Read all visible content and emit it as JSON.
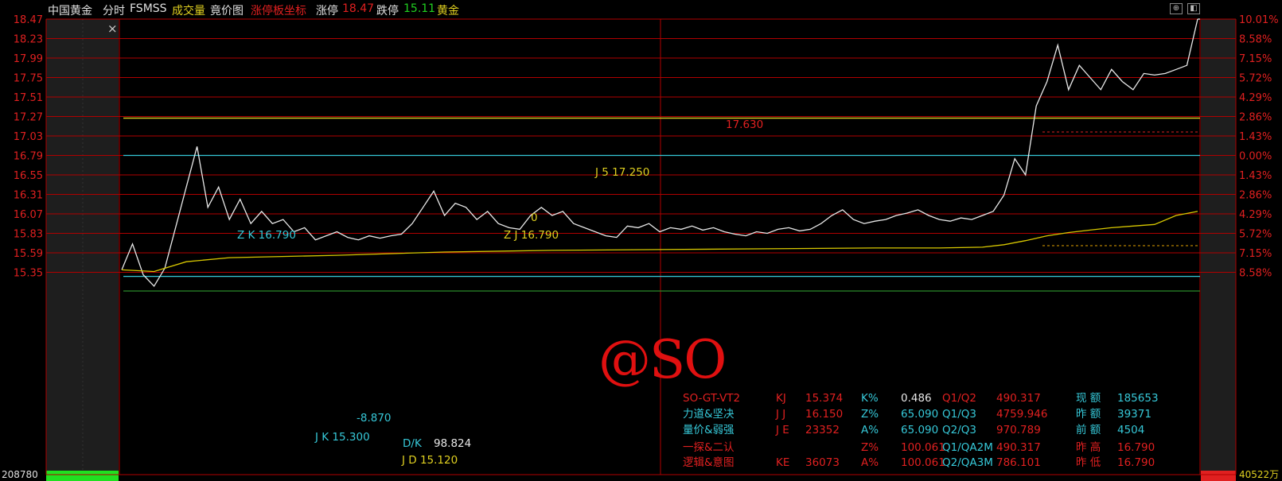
{
  "toolbar": {
    "stock_name": "中国黄金",
    "mode": "分时",
    "indicator": "FSMSS",
    "volume_label": "成交量",
    "auction_label": "竟价图",
    "limit_coord_label": "涨停板坐标",
    "limit_up_label": "涨停",
    "limit_up_value": "18.47",
    "limit_down_label": "跌停",
    "limit_down_value": "15.11",
    "sector": "黄金"
  },
  "colors": {
    "grid": "#b00000",
    "price_line": "#e8e8e8",
    "avg_line": "#d8c800",
    "cyan": "#36c8d8",
    "yellow": "#e0d020",
    "red": "#e02020",
    "white": "#e8e8e8"
  },
  "left_axis": [
    "18.47",
    "18.23",
    "17.99",
    "17.75",
    "17.51",
    "17.27",
    "17.03",
    "16.79",
    "16.55",
    "16.31",
    "16.07",
    "15.83",
    "15.59",
    "15.35"
  ],
  "right_axis": [
    "10.01%",
    "8.58%",
    "7.15%",
    "5.72%",
    "4.29%",
    "2.86%",
    "1.43%",
    "0.00%",
    "1.43%",
    "2.86%",
    "4.29%",
    "5.72%",
    "7.15%",
    "8.58%"
  ],
  "volume_left": "208780",
  "volume_right": "40522万",
  "annotations": {
    "j5": "J 5   17.250",
    "val_17630": "17.630",
    "zero": "0",
    "zk": "Z K  16.790",
    "zj": "Z J    16.790",
    "neg8870": "-8.870",
    "jk": "J K      15.300",
    "dk_label": "D/K",
    "dk_value": "98.824",
    "jd": "J D    15.120"
  },
  "info_table": [
    [
      "SO-GT-VT2",
      "KJ",
      "15.374",
      "K%",
      "0.486",
      "Q1/Q2",
      "490.317",
      "现 额",
      "185653"
    ],
    [
      "力道&坚决",
      "J J",
      "16.150",
      "Z%",
      "65.090",
      "Q1/Q3",
      "4759.946",
      "昨 额",
      "39371"
    ],
    [
      "量价&弱强",
      "J E",
      "23352",
      "A%",
      "65.090",
      "Q2/Q3",
      "970.789",
      "前 额",
      "4504"
    ],
    [
      "一探&二认",
      "",
      "",
      "Z%",
      "100.061",
      "Q1/QA2M",
      "490.317",
      "昨 高",
      "16.790"
    ],
    [
      "逻辑&意图",
      "KE",
      "36073",
      "A%",
      "100.061",
      "Q2/QA3M",
      "786.101",
      "昨 低",
      "16.790"
    ]
  ],
  "watermark": "@SO",
  "close_icon_glyph": "×",
  "chart_data": {
    "type": "line",
    "ylim": [
      15.11,
      18.47
    ],
    "reference_price": 16.79,
    "series": [
      {
        "name": "price",
        "x": [
          0,
          1,
          2,
          3,
          4,
          5,
          6,
          7,
          8,
          9,
          10,
          11,
          12,
          13,
          14,
          15,
          16,
          17,
          18,
          19,
          20,
          21,
          22,
          23,
          24,
          25,
          26,
          27,
          28,
          29,
          30,
          31,
          32,
          33,
          34,
          35,
          36,
          37,
          38,
          39,
          40,
          41,
          42,
          43,
          44,
          45,
          46,
          47,
          48,
          49,
          50,
          51,
          52,
          53,
          54,
          55,
          56,
          57,
          58,
          59,
          60,
          61,
          62,
          63,
          64,
          65,
          66,
          67,
          68,
          69,
          70,
          71,
          72,
          73,
          74,
          75,
          76,
          77,
          78,
          79,
          80,
          81,
          82,
          83,
          84,
          85,
          86,
          87,
          88,
          89,
          90,
          91,
          92,
          93,
          94,
          95,
          96,
          97,
          98,
          99,
          100
        ],
        "y": [
          15.38,
          15.7,
          15.32,
          15.18,
          15.4,
          15.9,
          16.4,
          16.9,
          16.15,
          16.4,
          16.0,
          16.25,
          15.95,
          16.1,
          15.95,
          16.0,
          15.85,
          15.9,
          15.75,
          15.8,
          15.85,
          15.78,
          15.75,
          15.8,
          15.77,
          15.8,
          15.82,
          15.95,
          16.15,
          16.35,
          16.05,
          16.2,
          16.15,
          16.0,
          16.1,
          15.95,
          15.9,
          15.88,
          16.05,
          16.15,
          16.05,
          16.1,
          15.95,
          15.9,
          15.85,
          15.8,
          15.78,
          15.92,
          15.9,
          15.95,
          15.85,
          15.9,
          15.88,
          15.92,
          15.87,
          15.9,
          15.85,
          15.82,
          15.8,
          15.85,
          15.83,
          15.88,
          15.9,
          15.86,
          15.88,
          15.95,
          16.05,
          16.12,
          16.0,
          15.95,
          15.98,
          16.0,
          16.05,
          16.08,
          16.12,
          16.05,
          16.0,
          15.98,
          16.02,
          16.0,
          16.05,
          16.1,
          16.3,
          16.75,
          16.55,
          17.4,
          17.7,
          18.15,
          17.6,
          17.9,
          17.75,
          17.6,
          17.85,
          17.7,
          17.6,
          17.8,
          17.78,
          17.8,
          17.85,
          17.9,
          18.47
        ],
        "color": "#e8e8e8"
      },
      {
        "name": "average",
        "x": [
          0,
          3,
          6,
          10,
          20,
          30,
          40,
          50,
          60,
          70,
          76,
          80,
          82,
          84,
          86,
          88,
          90,
          92,
          94,
          96,
          98,
          100
        ],
        "y": [
          15.38,
          15.36,
          15.48,
          15.53,
          15.56,
          15.6,
          15.62,
          15.63,
          15.64,
          15.65,
          15.65,
          15.66,
          15.69,
          15.74,
          15.8,
          15.84,
          15.87,
          15.9,
          15.92,
          15.94,
          16.05,
          16.1
        ],
        "color": "#d8c800"
      }
    ],
    "levels": [
      {
        "y": 17.25,
        "color": "#e0d020"
      },
      {
        "y": 16.79,
        "color": "#36c8d8"
      },
      {
        "y": 15.3,
        "color": "#36c8d8"
      },
      {
        "y": 15.12,
        "color": "#2a8a2a"
      }
    ]
  }
}
